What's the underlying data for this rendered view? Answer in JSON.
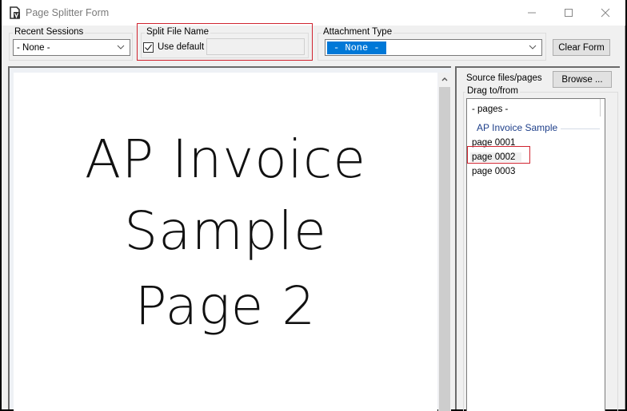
{
  "window": {
    "title": "Page Splitter Form",
    "icon": "document-v-icon",
    "controls": [
      "minimize",
      "maximize",
      "close"
    ]
  },
  "recent_sessions": {
    "label": "Recent Sessions",
    "selected": "- None -"
  },
  "split_file_name": {
    "label": "Split File Name",
    "use_default_label": "Use default",
    "use_default_checked": true,
    "filename_value": ""
  },
  "attachment_type": {
    "label": "Attachment Type",
    "selected": "- None -"
  },
  "clear_form_label": "Clear Form",
  "preview": {
    "lines": [
      "AP Invoice",
      "Sample",
      "Page 2"
    ]
  },
  "source": {
    "label": "Source files/pages",
    "browse_label": "Browse ...",
    "drag_label": "Drag to/from",
    "pages_header": "- pages -",
    "group_name": "AP Invoice Sample",
    "pages": [
      "page 0001",
      "page 0002",
      "page 0003"
    ],
    "selected_page": "page 0002"
  },
  "colors": {
    "highlight_red": "#d0232f",
    "selection_blue": "#0078d7",
    "group_text": "#1e3f8a"
  }
}
